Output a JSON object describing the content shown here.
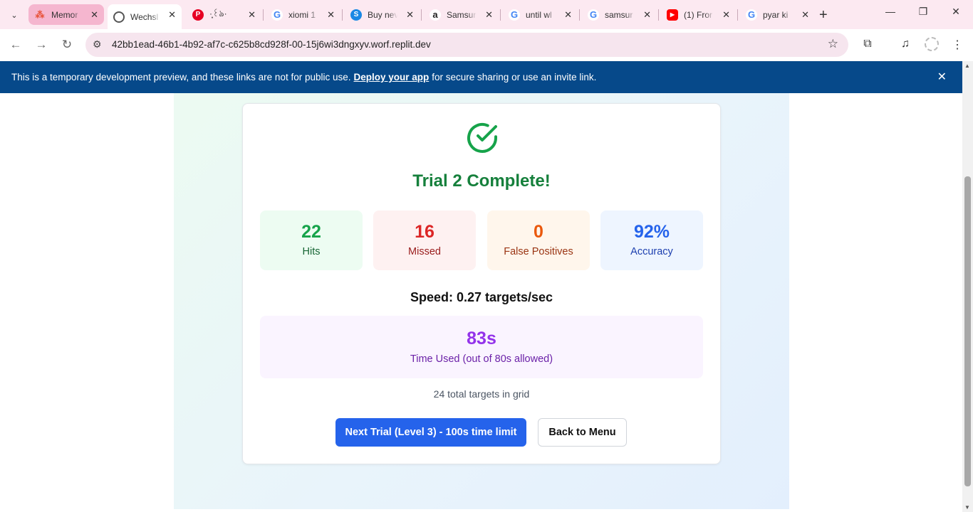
{
  "browser": {
    "tabs": [
      {
        "title": "Memor",
        "favicon": "memor-icon",
        "color": "#e8543c"
      },
      {
        "title": "Wechsl",
        "favicon": "globe-icon",
        "color": "#555555"
      },
      {
        "title": "·̩͙꒰ঌ·",
        "favicon": "pinterest-icon",
        "color": "#e60023"
      },
      {
        "title": "xiomi 1",
        "favicon": "google-icon",
        "color": "#4285f4"
      },
      {
        "title": "Buy nev",
        "favicon": "skype-icon",
        "color": "#1a88e4"
      },
      {
        "title": "Samsur",
        "favicon": "amazon-icon",
        "color": "#222222"
      },
      {
        "title": "until wl",
        "favicon": "google-icon",
        "color": "#4285f4"
      },
      {
        "title": "samsur",
        "favicon": "google-icon",
        "color": "#4285f4"
      },
      {
        "title": "(1) Fror",
        "favicon": "youtube-icon",
        "color": "#ff0000"
      },
      {
        "title": "pyar ki",
        "favicon": "google-icon",
        "color": "#4285f4"
      }
    ],
    "url": "42bb1ead-46b1-4b92-af7c-c625b8cd928f-00-15j6wi3dngxyv.worf.replit.dev"
  },
  "banner": {
    "text_before": "This is a temporary development preview, and these links are not for public use.",
    "link": "Deploy your app",
    "text_after": "for secure sharing or use an invite link."
  },
  "results": {
    "title": "Trial 2 Complete!",
    "stats": [
      {
        "value": "22",
        "label": "Hits"
      },
      {
        "value": "16",
        "label": "Missed"
      },
      {
        "value": "0",
        "label": "False Positives"
      },
      {
        "value": "92%",
        "label": "Accuracy"
      }
    ],
    "speed": "Speed: 0.27 targets/sec",
    "time_value": "83s",
    "time_label": "Time Used (out of 80s allowed)",
    "total_targets": "24 total targets in grid",
    "next_button": "Next Trial (Level 3) - 100s time limit",
    "back_button": "Back to Menu"
  },
  "colors": {
    "banner": "#06498a",
    "success": "#16a34a",
    "primary": "#2563eb"
  }
}
